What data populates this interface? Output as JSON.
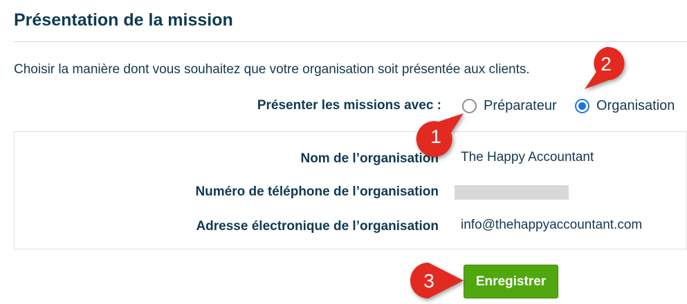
{
  "section": {
    "title": "Présentation de la mission",
    "description": "Choisir la manière dont vous souhaitez que votre organisation soit présentée aux clients."
  },
  "present_with": {
    "label": "Présenter les missions avec :",
    "options": [
      {
        "label": "Préparateur",
        "checked": false
      },
      {
        "label": "Organisation",
        "checked": true
      }
    ]
  },
  "organisation": {
    "name_label": "Nom de l’organisation",
    "name_value": "The Happy Accountant",
    "phone_label": "Numéro de téléphone de l’organisation",
    "phone_value": "",
    "email_label": "Adresse électronique de l’organisation",
    "email_value": "info@thehappyaccountant.com"
  },
  "actions": {
    "save_label": "Enregistrer"
  },
  "callouts": {
    "one": "1",
    "two": "2",
    "three": "3"
  },
  "colors": {
    "callout_red": "#e32a21",
    "save_green": "#50a70f",
    "radio_blue": "#1a73e8",
    "heading_navy": "#0e3a52"
  }
}
